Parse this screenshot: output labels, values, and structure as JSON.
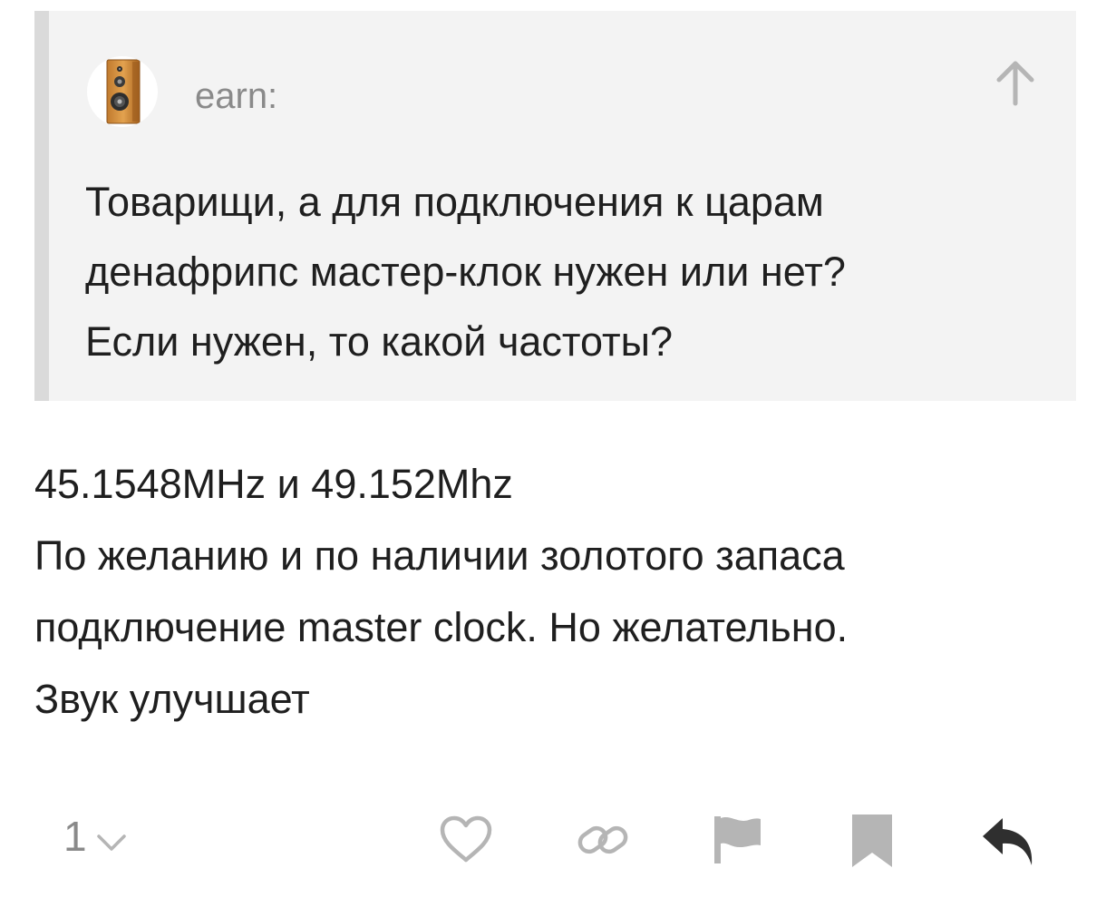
{
  "quote": {
    "author": "earn:",
    "lines": [
      "Товарищи, а для подключения к царам",
      "денафрипс мастер-клок нужен или нет?",
      "Если нужен, то какой частоты?"
    ],
    "avatar_icon": "speaker-cabinet-icon",
    "jump_icon": "arrow-up-icon"
  },
  "comment": {
    "lines": [
      "45.1548MHz и 49.152Mhz",
      "По желанию и по наличии золотого запаса",
      "подключение master clock. Но желательно.",
      "Звук улучшает"
    ]
  },
  "footer": {
    "rating": "1",
    "rating_icon": "chevron-down-icon",
    "actions": [
      "heart-icon",
      "link-icon",
      "flag-icon",
      "bookmark-icon",
      "reply-icon"
    ]
  },
  "colors": {
    "quote_background": "#f3f3f3",
    "quote_bar": "#dadada",
    "muted_text": "#8a8a8a",
    "text": "#1f1f1f",
    "icon": "#b5b5b5",
    "reply_icon": "#2f2f2f"
  }
}
